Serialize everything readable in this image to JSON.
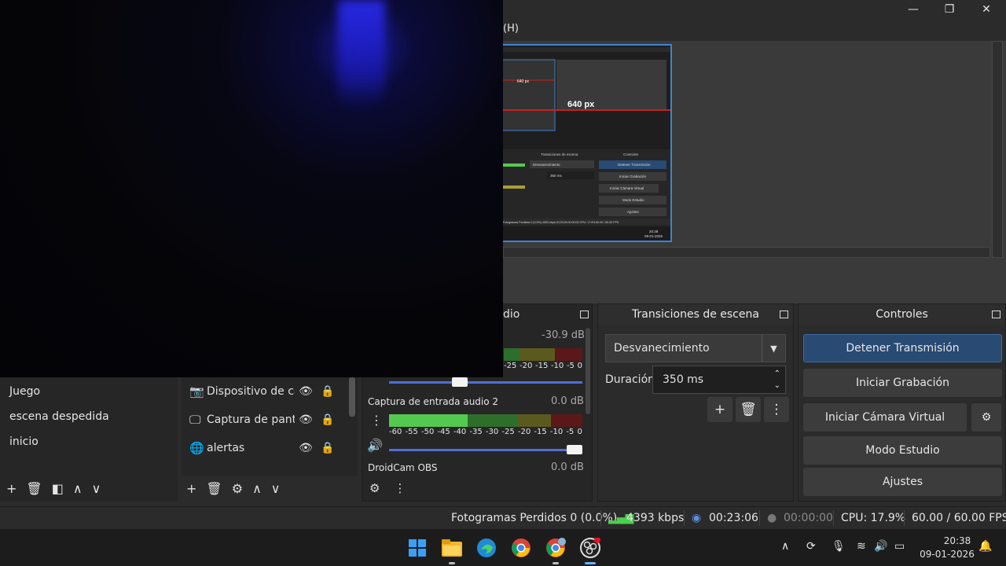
{
  "window": {
    "menu_help": "(H)",
    "minimize": "—",
    "maximize": "❐",
    "close": "✕"
  },
  "preview": {
    "mini_label": "640 px",
    "mini_label_small": "640 px",
    "mini_transition": "Desvanecimiento",
    "mini_duration": "350 ms",
    "mini_btns": [
      "Detener Transmisión",
      "Iniciar Grabación",
      "Iniciar Cámara Virtual",
      "Modo Estudio",
      "Ajustes"
    ],
    "mini_status": "Fotogramas Perdidos 0 (0.0%)  4393 kbps  00:23:06  00:00:00  CPU: 17.9%  60.00 / 60.00 FPS",
    "mini_headers": [
      "Transiciones de escena",
      "Controles"
    ],
    "mini_time": "20:38",
    "mini_date": "09-01-2026"
  },
  "scenes": {
    "items": [
      "Juego",
      "escena despedida",
      "inicio"
    ],
    "toolbar": {
      "add": "+",
      "remove": "🗑",
      "filter": "◧",
      "up": "∧",
      "down": "∨"
    }
  },
  "sources": {
    "items": [
      {
        "icon": "camera-icon",
        "label": "Dispositivo de captura de video"
      },
      {
        "icon": "monitor-icon",
        "label": "Captura de pantalla"
      },
      {
        "icon": "browser-icon",
        "label": "alertas"
      }
    ],
    "toolbar": {
      "add": "+",
      "remove": "🗑",
      "settings": "⚙",
      "up": "∧",
      "down": "∨"
    }
  },
  "audio": {
    "title_fragment": "dio",
    "channels": [
      {
        "name": "",
        "db": "-30.9 dB"
      },
      {
        "name": "Captura de entrada audio 2",
        "db": "0.0 dB"
      },
      {
        "name": "DroidCam OBS",
        "db": "0.0 dB"
      }
    ],
    "ticks_partial": [
      "-25",
      "-20",
      "-15",
      "-10",
      "-5",
      "0"
    ],
    "ticks": [
      "-60",
      "-55",
      "-50",
      "-45",
      "-40",
      "-35",
      "-30",
      "-25",
      "-20",
      "-15",
      "-10",
      "-5",
      "0"
    ],
    "volumes": [
      0.4,
      1.0
    ]
  },
  "transitions": {
    "title": "Transiciones de escena",
    "selected": "Desvanecimiento",
    "duration_label": "Duración",
    "duration_value": "350 ms"
  },
  "controls": {
    "title": "Controles",
    "stop_stream": "Detener Transmisión",
    "start_recording": "Iniciar Grabación",
    "start_virtual_cam": "Iniciar Cámara Virtual",
    "studio_mode": "Modo Estudio",
    "settings": "Ajustes"
  },
  "status": {
    "dropped_frames": "Fotogramas Perdidos 0 (0.0%)",
    "bitrate": "4393 kbps",
    "stream_time": "00:23:06",
    "record_time": "00:00:00",
    "cpu": "CPU: 17.9%",
    "fps": "60.00 / 60.00 FPS"
  },
  "taskbar": {
    "time": "20:38",
    "date": "09-01-2026"
  },
  "colors": {
    "accent": "#3d84d6",
    "stream_button": "#284a73",
    "meter_green": "#54c94f",
    "meter_yellow": "#a6a233",
    "meter_red": "#b02a2a"
  }
}
